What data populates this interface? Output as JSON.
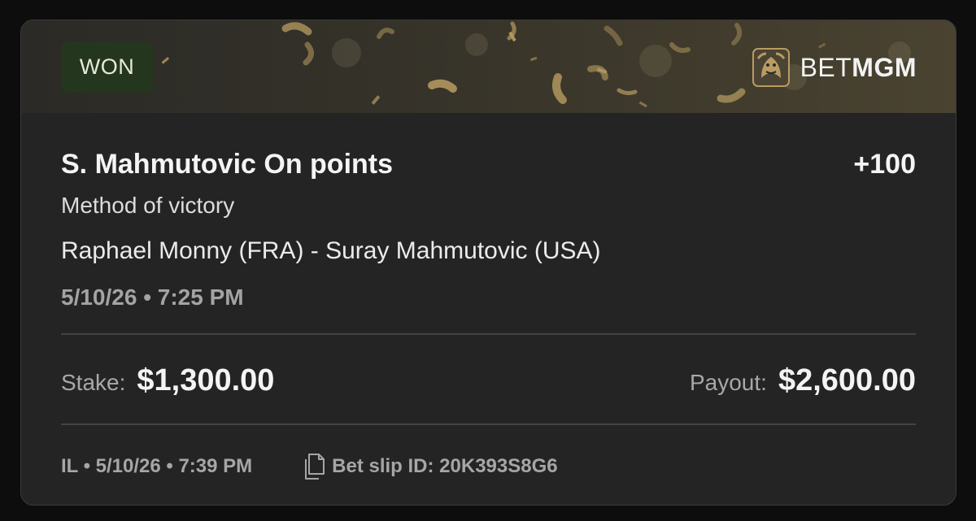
{
  "status": {
    "label": "WON",
    "color": "#24361d"
  },
  "brand": {
    "bet": "BET",
    "mgm": "MGM",
    "logo_icon": "lion-logo-icon"
  },
  "bet": {
    "selection": "S. Mahmutovic On points",
    "odds": "+100",
    "market": "Method of victory",
    "event": "Raphael Monny (FRA) - Suray Mahmutovic (USA)",
    "event_time": "5/10/26 • 7:25 PM"
  },
  "amounts": {
    "stake_label": "Stake:",
    "stake_value": "$1,300.00",
    "payout_label": "Payout:",
    "payout_value": "$2,600.00"
  },
  "footer": {
    "placed": "IL • 5/10/26 • 7:39 PM",
    "slip_icon": "copy-icon",
    "slip_text": "Bet slip ID: 20K393S8G6"
  },
  "colors": {
    "accent_gold": "#b89c62",
    "card_bg": "#242424"
  }
}
